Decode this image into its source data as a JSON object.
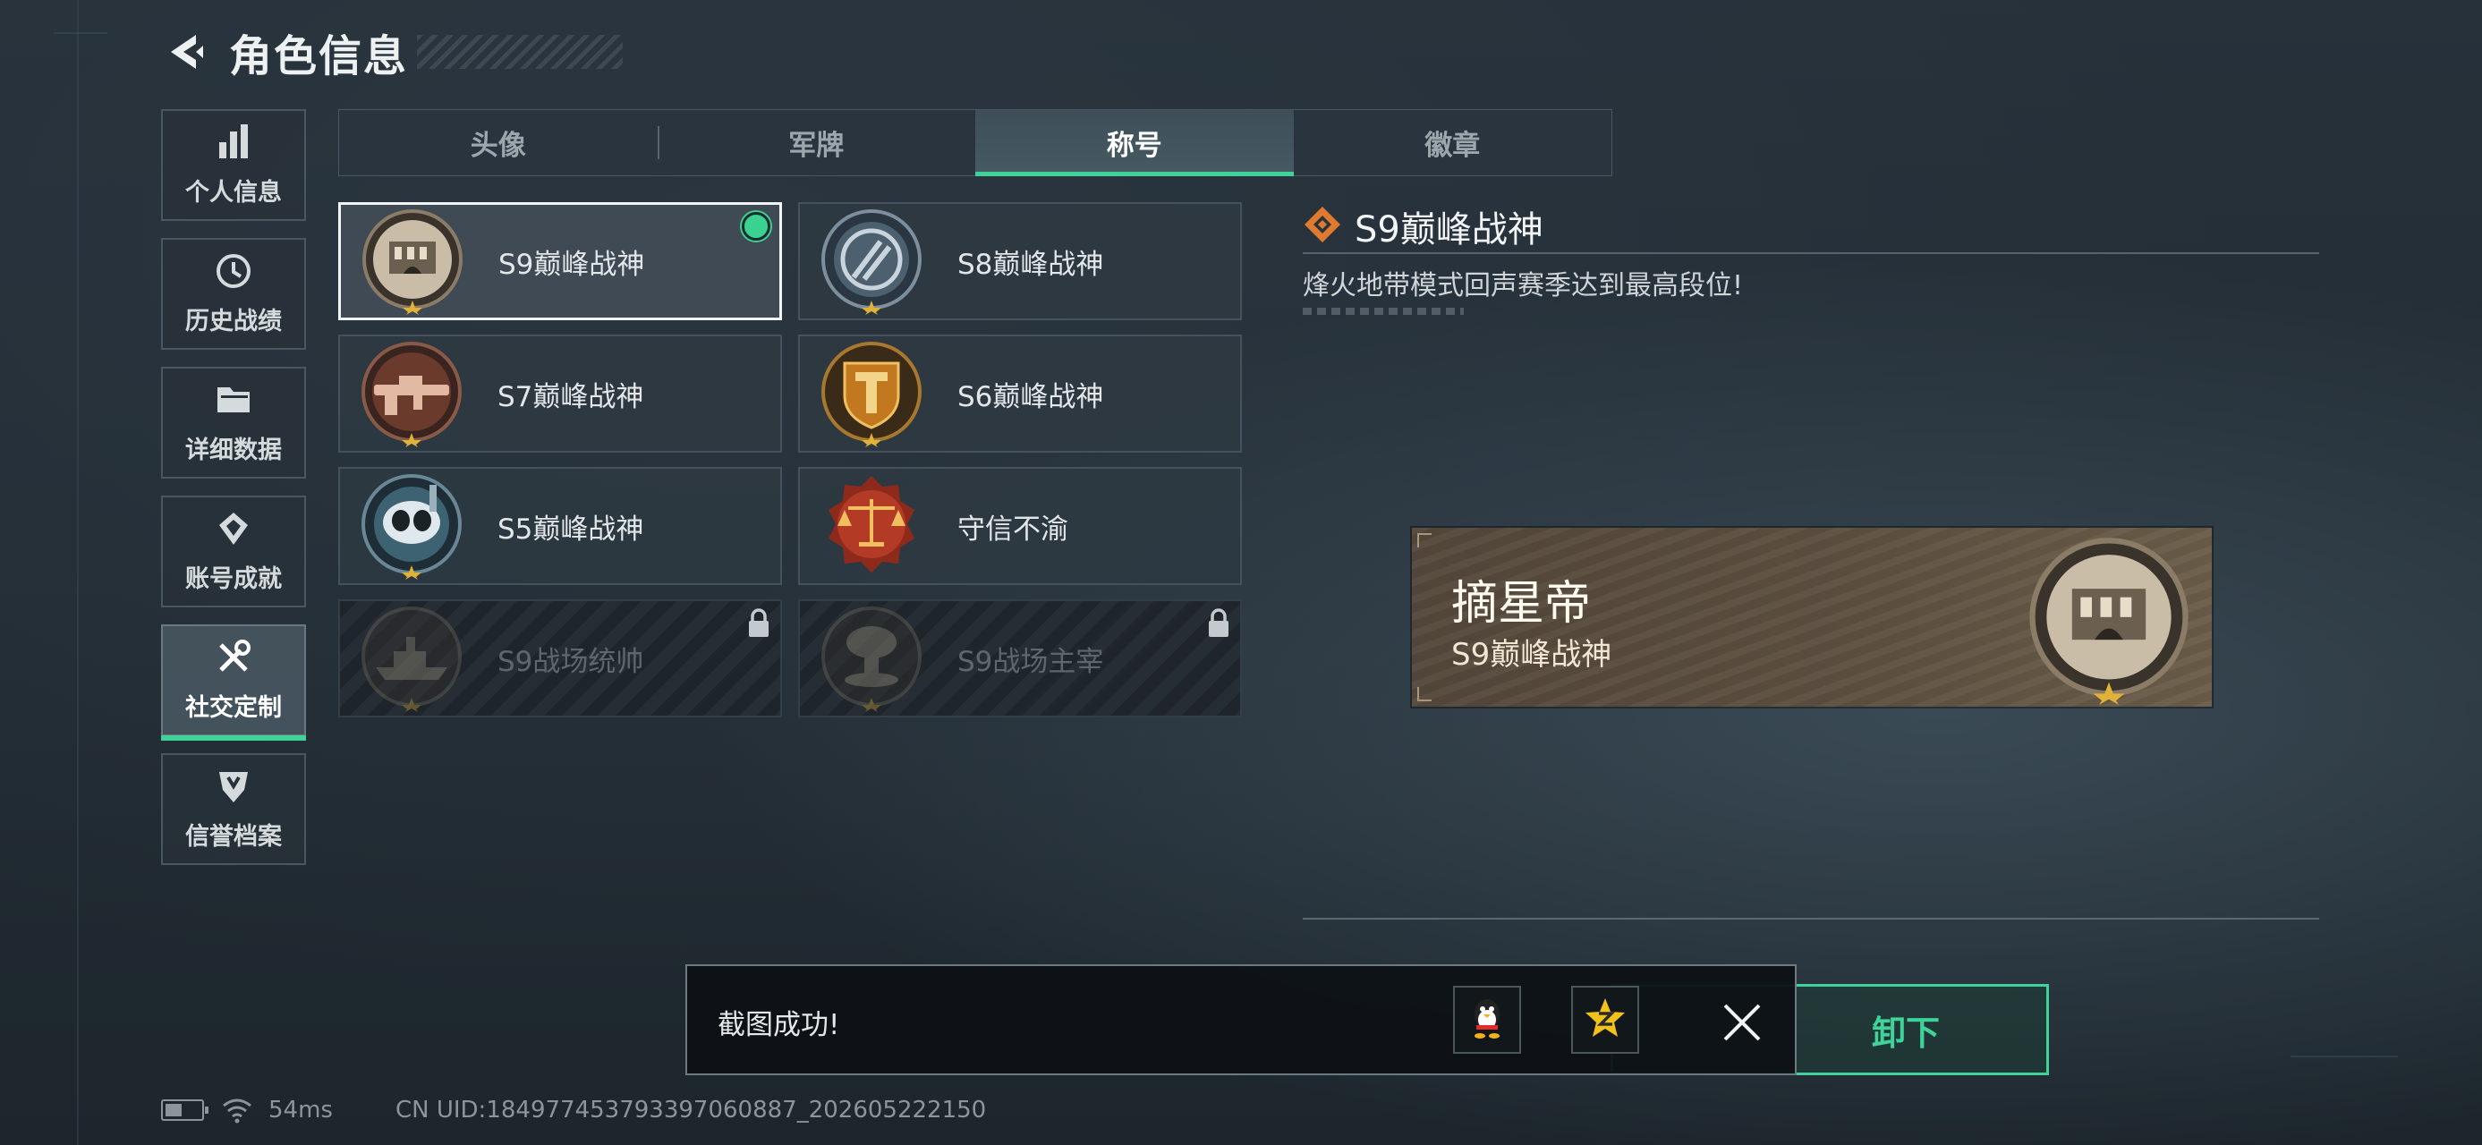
{
  "header": {
    "title": "角色信息"
  },
  "nav": [
    {
      "id": "personal",
      "label": "个人信息",
      "icon": "bar-chart-icon",
      "active": false
    },
    {
      "id": "history",
      "label": "历史战绩",
      "icon": "clock-icon",
      "active": false
    },
    {
      "id": "details",
      "label": "详细数据",
      "icon": "folder-icon",
      "active": false
    },
    {
      "id": "achievements",
      "label": "账号成就",
      "icon": "medal-icon",
      "active": false
    },
    {
      "id": "social",
      "label": "社交定制",
      "icon": "tools-icon",
      "active": true
    },
    {
      "id": "credit",
      "label": "信誉档案",
      "icon": "shield-icon",
      "active": false
    }
  ],
  "tabs": [
    {
      "label": "头像",
      "active": false
    },
    {
      "label": "军牌",
      "active": false
    },
    {
      "label": "称号",
      "active": true
    },
    {
      "label": "徽章",
      "active": false
    }
  ],
  "titles": [
    {
      "label": "S9巅峰战神",
      "badge": "fortress-badge-icon",
      "selected": true,
      "equipped": true,
      "locked": false
    },
    {
      "label": "S8巅峰战神",
      "badge": "emblem-badge-icon",
      "selected": false,
      "equipped": false,
      "locked": false
    },
    {
      "label": "S7巅峰战神",
      "badge": "rifle-badge-icon",
      "selected": false,
      "equipped": false,
      "locked": false
    },
    {
      "label": "S6巅峰战神",
      "badge": "shield-t-badge-icon",
      "selected": false,
      "equipped": false,
      "locked": false
    },
    {
      "label": "S5巅峰战神",
      "badge": "diver-badge-icon",
      "selected": false,
      "equipped": false,
      "locked": false
    },
    {
      "label": "守信不渝",
      "badge": "scales-badge-icon",
      "selected": false,
      "equipped": false,
      "locked": false
    },
    {
      "label": "S9战场统帅",
      "badge": "warship-badge-icon",
      "selected": false,
      "equipped": false,
      "locked": true
    },
    {
      "label": "S9战场主宰",
      "badge": "mushroom-cloud-badge-icon",
      "selected": false,
      "equipped": false,
      "locked": true
    }
  ],
  "detail": {
    "title": "S9巅峰战神",
    "description": "烽火地带模式回声赛季达到最高段位!"
  },
  "preview": {
    "player_name": "摘星帝",
    "title": "S9巅峰战神"
  },
  "toast": {
    "message": "截图成功!"
  },
  "unequip_button": {
    "label": "卸下"
  },
  "status": {
    "ping": "54ms",
    "uid": "CN UID:18497745379339706088​7_202605222150"
  },
  "colors": {
    "accent": "#3fd39a",
    "diamond": "#e07a2e",
    "gold_star": "#e0b23a"
  }
}
